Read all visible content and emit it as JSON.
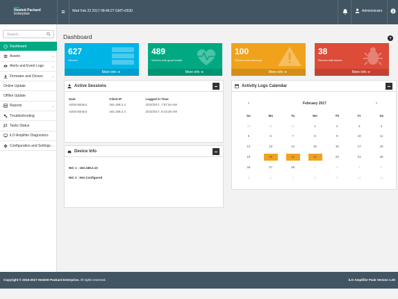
{
  "topbar": {
    "logo_line1": "Hewlett Packard",
    "logo_line2": "Enterprise",
    "datetime": "Wed Feb 22 2017 08:49:27 GMT+0530",
    "user": "Administrator"
  },
  "sidebar": {
    "search_placeholder": "Search...",
    "items": [
      {
        "label": "Dashboard",
        "icon": "dashboard-icon",
        "active": true,
        "chevron": false
      },
      {
        "label": "Assets",
        "icon": "list-icon",
        "chevron": true
      },
      {
        "label": "Alerts and Event Logs",
        "icon": "eye-icon",
        "chevron": true
      },
      {
        "label": "Firmware and Drivers",
        "icon": "download-icon",
        "chevron": true
      },
      {
        "label": "Online Update",
        "icon": "",
        "chevron": false
      },
      {
        "label": "Offline Update",
        "icon": "",
        "chevron": false
      },
      {
        "label": "Reports",
        "icon": "report-icon",
        "chevron": true
      },
      {
        "label": "Troubleshooting",
        "icon": "wrench-icon",
        "chevron": false
      },
      {
        "label": "Tasks Status",
        "icon": "flag-icon",
        "chevron": false
      },
      {
        "label": "iLO Amplifier Diagnostics",
        "icon": "monitor-icon",
        "chevron": false
      },
      {
        "label": "Configuration and Settings",
        "icon": "gear-icon",
        "chevron": true
      }
    ]
  },
  "page": {
    "title": "Dashboard"
  },
  "tiles": [
    {
      "number": "627",
      "label": "Servers",
      "more": "More info",
      "color": "#00b4e6",
      "icon": "server-stack-icon"
    },
    {
      "number": "489",
      "label": "Servers with good health",
      "more": "More info",
      "color": "#01a982",
      "icon": "heartbeat-icon"
    },
    {
      "number": "100",
      "label": "Servers with warnings",
      "more": "More info",
      "color": "#f0a21c",
      "icon": "warning-icon"
    },
    {
      "number": "38",
      "label": "Servers with issues",
      "more": "More info",
      "color": "#dd4b39",
      "icon": "bug-icon"
    }
  ],
  "sessions": {
    "title": "Active Sessions",
    "columns": [
      "User",
      "Client IP",
      "Logged in Time"
    ],
    "rows": [
      [
        "Administrator",
        "192.168.2.4",
        "2/22/2017, 7:57:54 AM"
      ],
      [
        "Administrator",
        "192.168.2.4",
        "2/22/2017, 8:43:25 AM"
      ]
    ]
  },
  "device": {
    "title": "Device Info",
    "nic1": "NIC 1 : 192.168.2.10",
    "nic2": "NIC 2 : Not Configured"
  },
  "calendar": {
    "title": "Activity Logs Calendar",
    "month": "February 2017",
    "prev": "‹",
    "next": "›",
    "days": [
      "Su",
      "Mo",
      "Tu",
      "We",
      "Th",
      "Fr",
      "Sa"
    ],
    "weeks": [
      [
        {
          "d": "29",
          "m": 1
        },
        {
          "d": "30",
          "m": 1
        },
        {
          "d": "31",
          "m": 1
        },
        {
          "d": "1"
        },
        {
          "d": "2"
        },
        {
          "d": "3"
        },
        {
          "d": "4"
        }
      ],
      [
        {
          "d": "5"
        },
        {
          "d": "6"
        },
        {
          "d": "7"
        },
        {
          "d": "8"
        },
        {
          "d": "9"
        },
        {
          "d": "10"
        },
        {
          "d": "11"
        }
      ],
      [
        {
          "d": "12"
        },
        {
          "d": "13"
        },
        {
          "d": "14"
        },
        {
          "d": "15"
        },
        {
          "d": "16"
        },
        {
          "d": "17"
        },
        {
          "d": "18"
        }
      ],
      [
        {
          "d": "19"
        },
        {
          "d": "20",
          "h": 1
        },
        {
          "d": "21",
          "h": 1
        },
        {
          "d": "22",
          "h": 1
        },
        {
          "d": "23"
        },
        {
          "d": "24"
        },
        {
          "d": "25"
        }
      ],
      [
        {
          "d": "26"
        },
        {
          "d": "27"
        },
        {
          "d": "28"
        },
        {
          "d": "1",
          "m": 1
        },
        {
          "d": "2",
          "m": 1
        },
        {
          "d": "3",
          "m": 1
        },
        {
          "d": "4",
          "m": 1
        }
      ],
      [
        {
          "d": "5",
          "m": 1
        },
        {
          "d": "6",
          "m": 1
        },
        {
          "d": "7",
          "m": 1
        },
        {
          "d": "8",
          "m": 1
        },
        {
          "d": "9",
          "m": 1
        },
        {
          "d": "10",
          "m": 1
        },
        {
          "d": "11",
          "m": 1
        }
      ]
    ]
  },
  "footer": {
    "copyright": "Copyright © 2016-2017 Hewlett Packard Enterprise.",
    "rights": "All rights reserved.",
    "version": "iLO Amplifier Pack Version 1.00"
  },
  "colors": {
    "accent": "#01a982",
    "header": "#425563"
  }
}
